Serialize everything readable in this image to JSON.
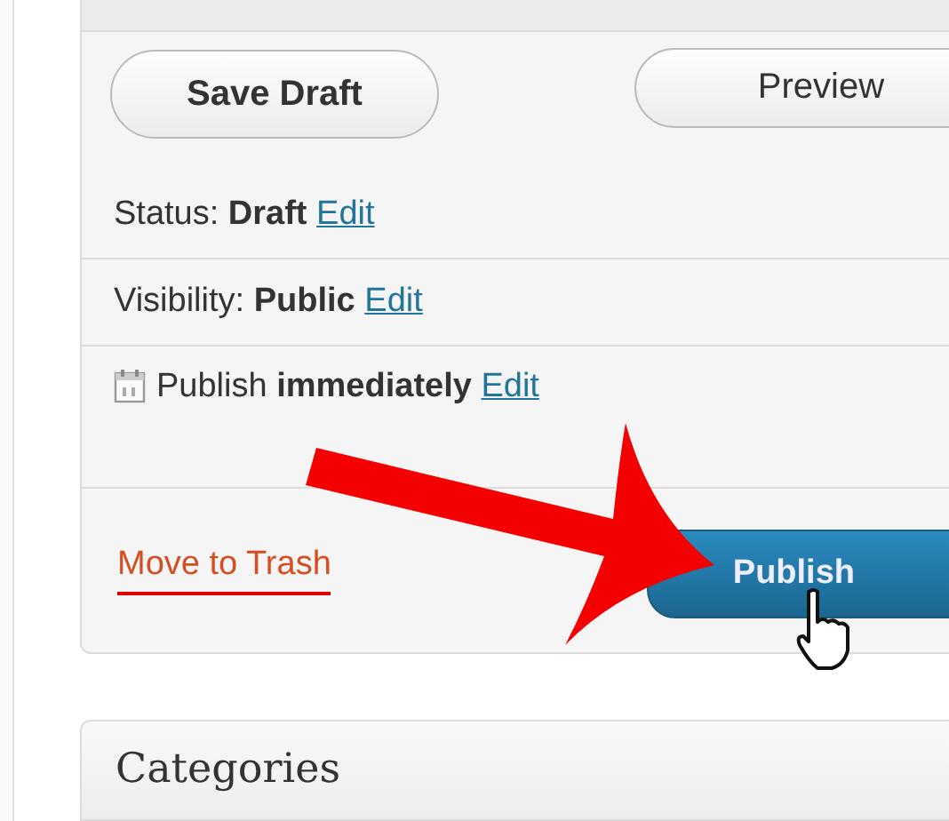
{
  "buttons": {
    "save_draft": "Save Draft",
    "preview": "Preview"
  },
  "rows": [
    {
      "kind": "text",
      "label": "Status:",
      "value": "Draft",
      "link": "Edit"
    },
    {
      "kind": "text",
      "label": "Visibility:",
      "value": "Public",
      "link": "Edit"
    },
    {
      "kind": "schedule",
      "label": "Publish",
      "value": "immediately",
      "link": "Edit"
    }
  ],
  "actions": {
    "trash": "Move to Trash",
    "publish": "Publish"
  },
  "next_box": {
    "title": "Categories"
  }
}
